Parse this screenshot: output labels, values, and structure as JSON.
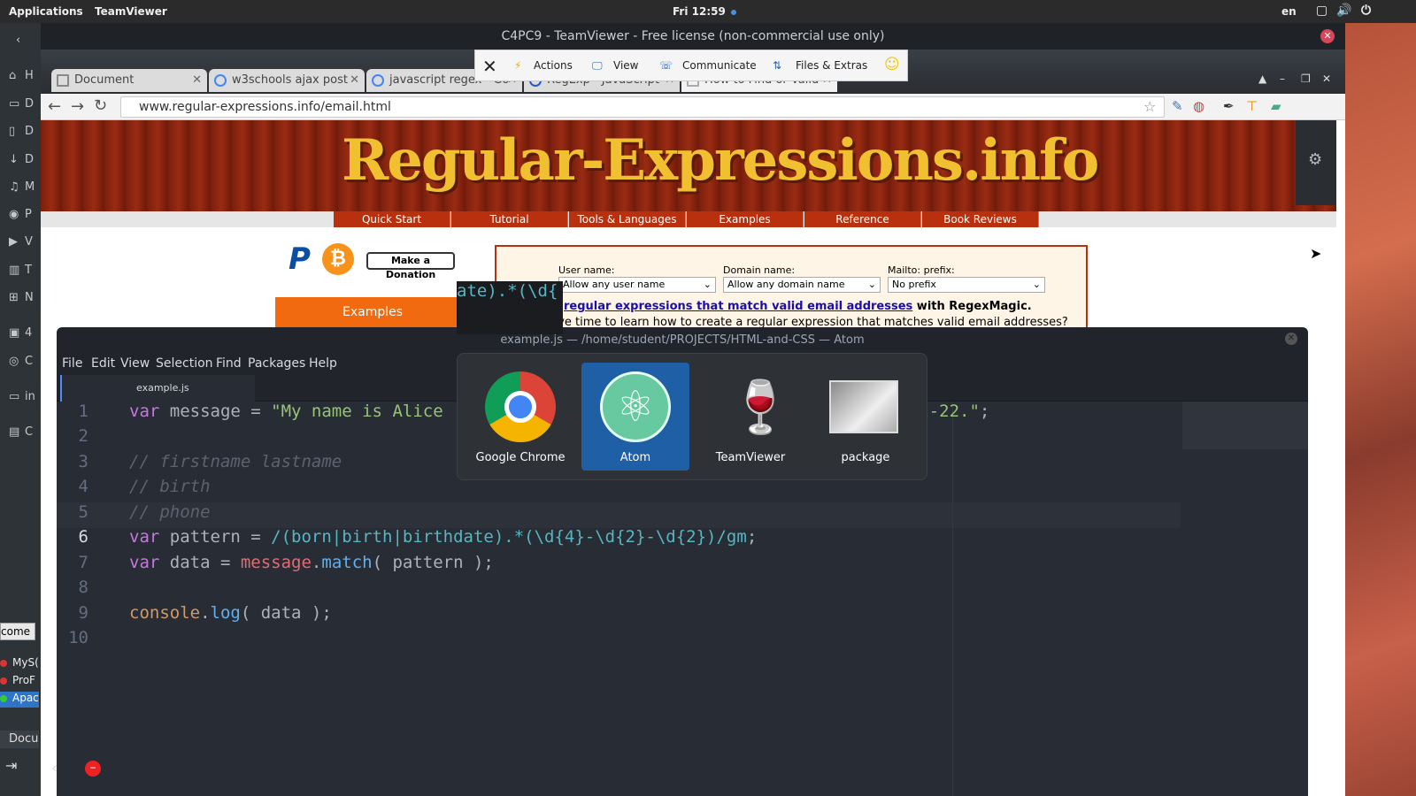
{
  "topbar": {
    "applications": "Applications",
    "app_name": "TeamViewer",
    "clock": "Fri 12:59",
    "lang": "en"
  },
  "gnome_sidebar": {
    "items": [
      "H",
      "D",
      "D",
      "D",
      "M",
      "P",
      "V",
      "T",
      "N",
      "4",
      "C",
      "in",
      "C"
    ]
  },
  "teamviewer": {
    "title": "C4PC9 - TeamViewer - Free license (non-commercial use only)",
    "toolbar": {
      "actions": "Actions",
      "view": "View",
      "communicate": "Communicate",
      "files_extras": "Files & Extras"
    }
  },
  "browser": {
    "tabs": [
      "Document",
      "w3schools ajax post",
      "javascript regex - Go",
      "RegExp - JavaScript",
      "How to Find or Valid"
    ],
    "url": "www.regular-expressions.info/email.html"
  },
  "site": {
    "title": "Regular-Expressions.info",
    "nav": [
      "Quick Start",
      "Tutorial",
      "Tools & Languages",
      "Examples",
      "Reference",
      "Book Reviews"
    ],
    "donation": "Make a Donation",
    "examples_button": "Examples",
    "labels": {
      "user": "User name:",
      "domain": "Domain name:",
      "mailto": "Mailto: prefix:"
    },
    "selects": {
      "user": "Allow any user name",
      "domain": "Allow any domain name",
      "mailto": "No prefix"
    },
    "link_text": "regular expressions that match valid email addresses",
    "link_suffix": " with RegexMagic.",
    "paragraph": "Don't have time to learn how to create a regular expression that matches valid email addresses?"
  },
  "atom": {
    "title": "example.js — /home/student/PROJECTS/HTML-and-CSS — Atom",
    "menu": [
      "File",
      "Edit",
      "View",
      "Selection",
      "Find",
      "Packages",
      "Help"
    ],
    "tab": "example.js",
    "line_numbers": [
      "1",
      "2",
      "3",
      "4",
      "5",
      "6",
      "7",
      "8",
      "9",
      "10"
    ]
  },
  "switcher": {
    "apps": [
      "Google Chrome",
      "Atom",
      "TeamViewer",
      "package"
    ]
  },
  "popup_code": "ate).*(\\d{",
  "left_dock": {
    "welcome": "come",
    "items": [
      "MyS(",
      "ProF",
      "Apac"
    ],
    "doc": "Docu"
  }
}
